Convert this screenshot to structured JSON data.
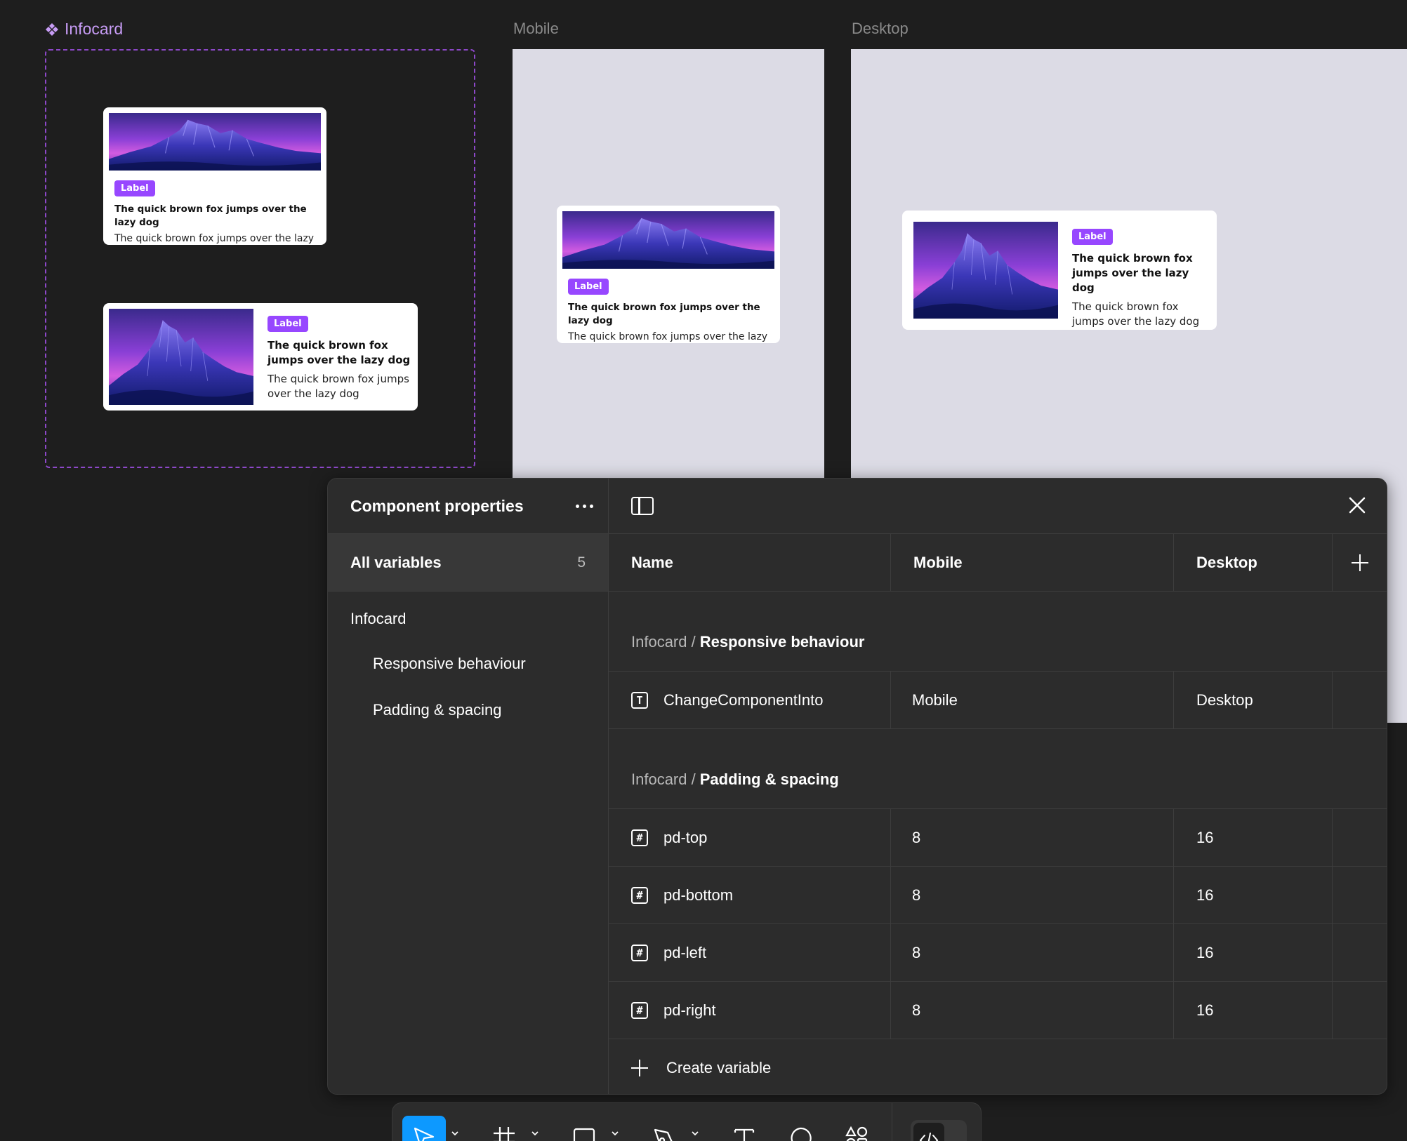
{
  "canvas": {
    "component_label": "Infocard",
    "mobile_frame_label": "Mobile",
    "desktop_frame_label": "Desktop"
  },
  "card": {
    "label": "Label",
    "title": "The quick brown fox jumps over the lazy dog",
    "body": "The quick brown fox jumps over the lazy dog"
  },
  "panel": {
    "title": "Component properties",
    "all_variables": {
      "label": "All variables",
      "count": "5"
    },
    "groups": [
      {
        "name": "Infocard",
        "subgroups": [
          "Responsive behaviour",
          "Padding & spacing"
        ]
      }
    ],
    "columns": {
      "name": "Name",
      "mode1": "Mobile",
      "mode2": "Desktop"
    },
    "sections": [
      {
        "prefix": "Infocard /",
        "name": "Responsive behaviour",
        "variables": [
          {
            "type_icon": "T",
            "name": "ChangeComponentInto",
            "mobile": "Mobile",
            "desktop": "Desktop"
          }
        ]
      },
      {
        "prefix": "Infocard /",
        "name": "Padding & spacing",
        "variables": [
          {
            "type_icon": "#",
            "name": "pd-top",
            "mobile": "8",
            "desktop": "16"
          },
          {
            "type_icon": "#",
            "name": "pd-bottom",
            "mobile": "8",
            "desktop": "16"
          },
          {
            "type_icon": "#",
            "name": "pd-left",
            "mobile": "8",
            "desktop": "16"
          },
          {
            "type_icon": "#",
            "name": "pd-right",
            "mobile": "8",
            "desktop": "16"
          }
        ]
      }
    ],
    "create_variable": "Create variable"
  },
  "toolbar": {
    "tools": [
      "move-tool",
      "frame-tool",
      "rectangle-tool",
      "pen-tool",
      "text-tool",
      "comment-tool",
      "actions-tool"
    ],
    "dev_mode": "dev-mode-toggle"
  },
  "colors": {
    "accent": "#9747ff",
    "selection": "#0d99ff",
    "panel_bg": "#2c2c2c",
    "canvas_bg": "#1e1e1e",
    "frame_bg": "#dcdbe5"
  }
}
